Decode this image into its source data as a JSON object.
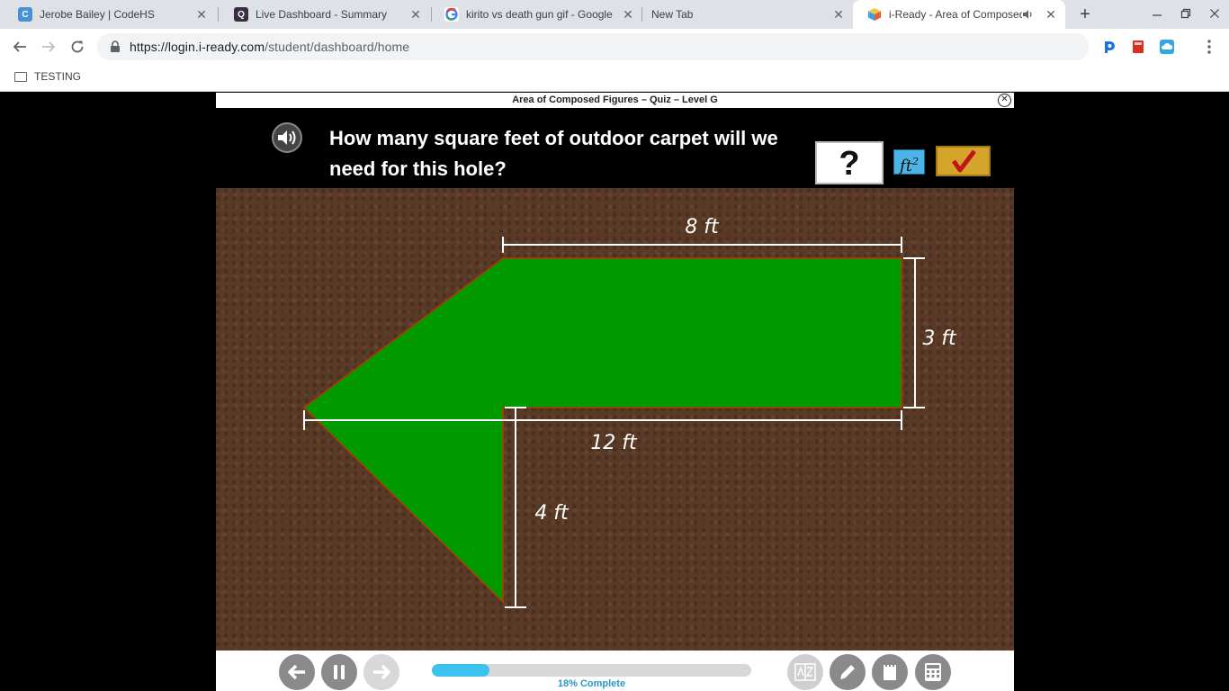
{
  "browser": {
    "tabs": [
      {
        "title": "Jerobe Bailey | CodeHS",
        "favicon_color": "#4a90d9",
        "active": false
      },
      {
        "title": "Live Dashboard - Summary",
        "favicon_color": "#3b2e44",
        "active": false
      },
      {
        "title": "kirito vs death gun gif - Google S",
        "favicon_color": "#ffffff",
        "active": false
      },
      {
        "title": "New Tab",
        "favicon_color": "",
        "active": false
      },
      {
        "title": "i-Ready - Area of Composed",
        "favicon_color": "#f0a030",
        "active": true
      }
    ],
    "close_glyph": "✕",
    "new_tab_glyph": "+",
    "url_host": "https://login.i-ready.com",
    "url_path": "/student/dashboard/home",
    "bookmark": "TESTING"
  },
  "lesson": {
    "title": "Area of Composed Figures – Quiz – Level G",
    "close_glyph": "✕",
    "question": "How many square feet of outdoor carpet will we need for this hole?",
    "answer_placeholder": "?",
    "unit_base": "ft",
    "unit_exp": "2",
    "figure_fill": "#009900",
    "figure_outline": "#b33a00",
    "labels": {
      "top": "8 ft",
      "right": "3 ft",
      "middle": "12 ft",
      "bottom": "4 ft"
    }
  },
  "progress": {
    "percent": 18,
    "label": "18% Complete"
  },
  "colors": {
    "accent": "#3cc2ef",
    "check": "#d4a52a",
    "unit_badge": "#4db5e6"
  },
  "icons": [
    "back-arrow-icon",
    "pause-icon",
    "forward-arrow-icon",
    "glossary-icon",
    "pencil-icon",
    "notepad-icon",
    "calculator-icon",
    "speaker-icon",
    "checkmark-icon"
  ]
}
